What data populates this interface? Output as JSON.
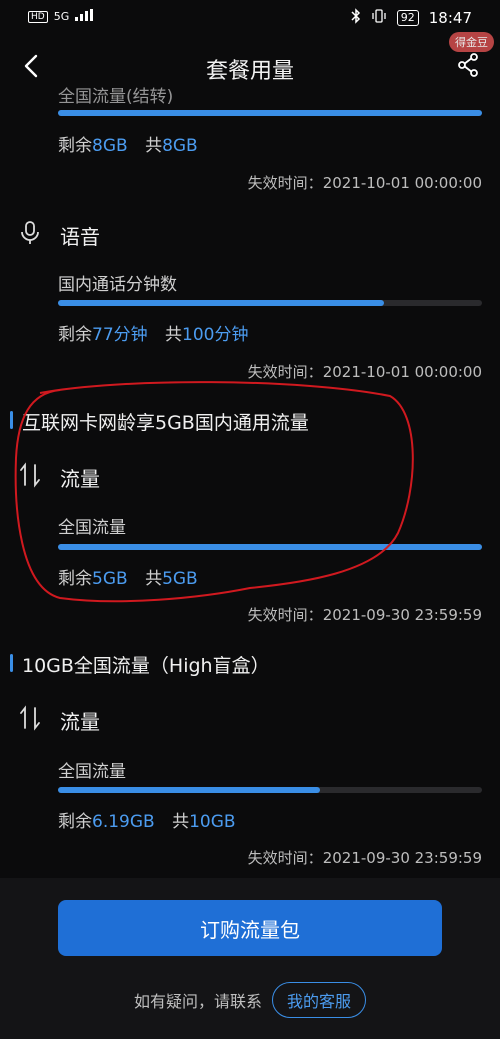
{
  "status_bar": {
    "network": "5G",
    "hd": "HD",
    "battery": "92",
    "time": "18:47"
  },
  "header": {
    "title": "套餐用量",
    "gold_badge": "得金豆"
  },
  "section0": {
    "partial_label": "全国流量(结转)",
    "remain_label": "剩余",
    "remain_value": "8GB",
    "total_label": "共",
    "total_value": "8GB",
    "progress": 1.0,
    "expire_label": "失效时间：",
    "expire_time": "2021-10-01 00:00:00"
  },
  "voice": {
    "category": "语音",
    "item_label": "国内通话分钟数",
    "progress": 0.77,
    "remain_label": "剩余",
    "remain_value": "77分钟",
    "total_label": "共",
    "total_value": "100分钟",
    "expire_label": "失效时间：",
    "expire_time": "2021-10-01 00:00:00"
  },
  "pkg1": {
    "title": "互联网卡网龄享5GB国内通用流量",
    "category": "流量",
    "item_label": "全国流量",
    "progress": 1.0,
    "remain_label": "剩余",
    "remain_value": "5GB",
    "total_label": "共",
    "total_value": "5GB",
    "expire_label": "失效时间：",
    "expire_time": "2021-09-30 23:59:59"
  },
  "pkg2": {
    "title": "10GB全国流量（High盲盒）",
    "category": "流量",
    "item_label": "全国流量",
    "progress": 0.619,
    "remain_label": "剩余",
    "remain_value": "6.19GB",
    "total_label": "共",
    "total_value": "10GB",
    "expire_label": "失效时间：",
    "expire_time": "2021-09-30 23:59:59"
  },
  "footer": {
    "buy_button": "订购流量包",
    "help_text": "如有疑问，请联系",
    "service_button": "我的客服"
  },
  "colors": {
    "accent": "#3a8ee6",
    "annotation": "#d0191f"
  }
}
